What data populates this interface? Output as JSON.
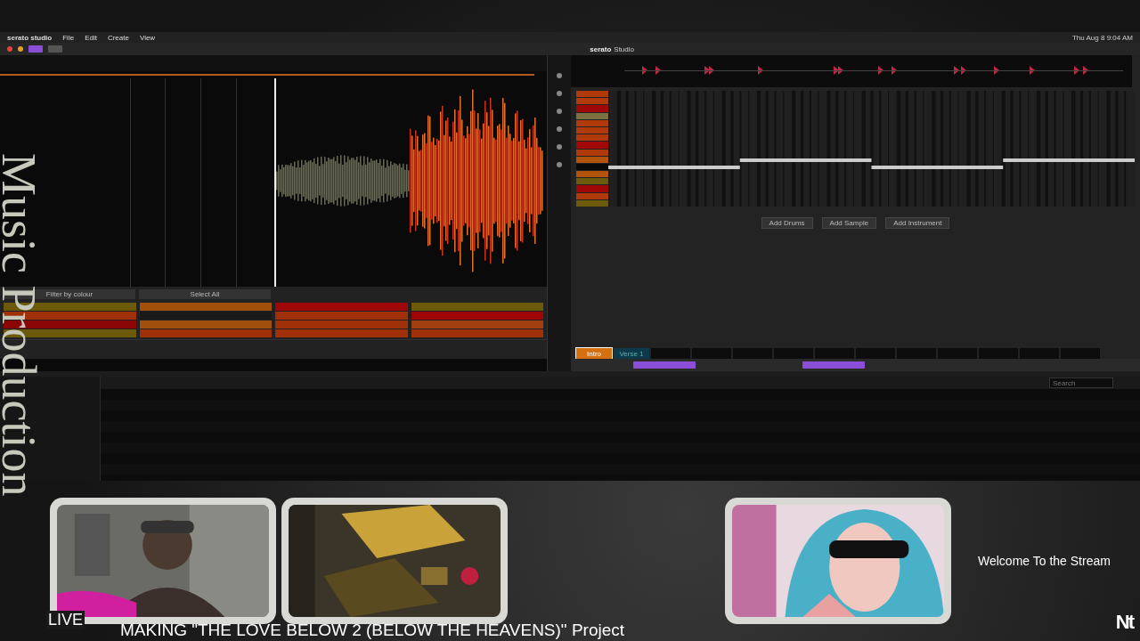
{
  "menu_bar": {
    "app": "serato studio",
    "items": [
      "File",
      "Edit",
      "Create",
      "View"
    ],
    "clock": "Thu Aug 8  9:04 AM"
  },
  "brand": {
    "logo": "serato",
    "sub": "Studio"
  },
  "pads": {
    "filter": "Filter by colour",
    "select": "Select All",
    "items": [
      {
        "color": "#6b5a0a"
      },
      {
        "color": "#a03008"
      },
      {
        "color": "#8a0505"
      },
      {
        "color": "#6b5a0a"
      },
      {
        "color": "#a0500a"
      },
      {
        "color": "#1a1a1a"
      },
      {
        "color": "#a0500a"
      },
      {
        "color": "#a03008"
      },
      {
        "color": "#a00808"
      },
      {
        "color": "#a03008"
      },
      {
        "color": "#a03008"
      },
      {
        "color": "#a03008"
      },
      {
        "color": "#6b5a0a"
      },
      {
        "color": "#a00505"
      },
      {
        "color": "#a04010"
      },
      {
        "color": "#a03008"
      }
    ]
  },
  "sequencer": {
    "lanes": [
      {
        "color": "#b03a0a"
      },
      {
        "color": "#b03a0a"
      },
      {
        "color": "#a00808"
      },
      {
        "color": "#7a7040"
      },
      {
        "color": "#b03a0a"
      },
      {
        "color": "#b03a0a"
      },
      {
        "color": "#b03a0a"
      },
      {
        "color": "#a00808"
      },
      {
        "color": "#b03a0a"
      },
      {
        "color": "#b0520a"
      },
      {
        "color": "#0a0a0a"
      },
      {
        "color": "#b0520a"
      },
      {
        "color": "#6b5a0a"
      },
      {
        "color": "#a00808"
      },
      {
        "color": "#b03a0a"
      },
      {
        "color": "#6b5a0a"
      }
    ],
    "buttons": [
      "Add Drums",
      "Add Sample",
      "Add Instrument"
    ]
  },
  "scenes": [
    {
      "label": "Intro",
      "color": "#d4700f",
      "selected": true
    },
    {
      "label": "Verse 1",
      "color": "#0d3a4a",
      "selected": false
    }
  ],
  "library": {
    "search": {
      "placeholder": "Search"
    }
  },
  "cameras": [
    {
      "kind": "person"
    },
    {
      "kind": "studio"
    },
    {
      "kind": "picture"
    }
  ],
  "overlay": {
    "side_title": "Music Production",
    "live": "LIVE",
    "project": "MAKING \"THE LOVE BELOW 2 (BELOW THE HEAVENS)\" Project",
    "welcome": "Welcome To the Stream",
    "logo": "Nt"
  }
}
